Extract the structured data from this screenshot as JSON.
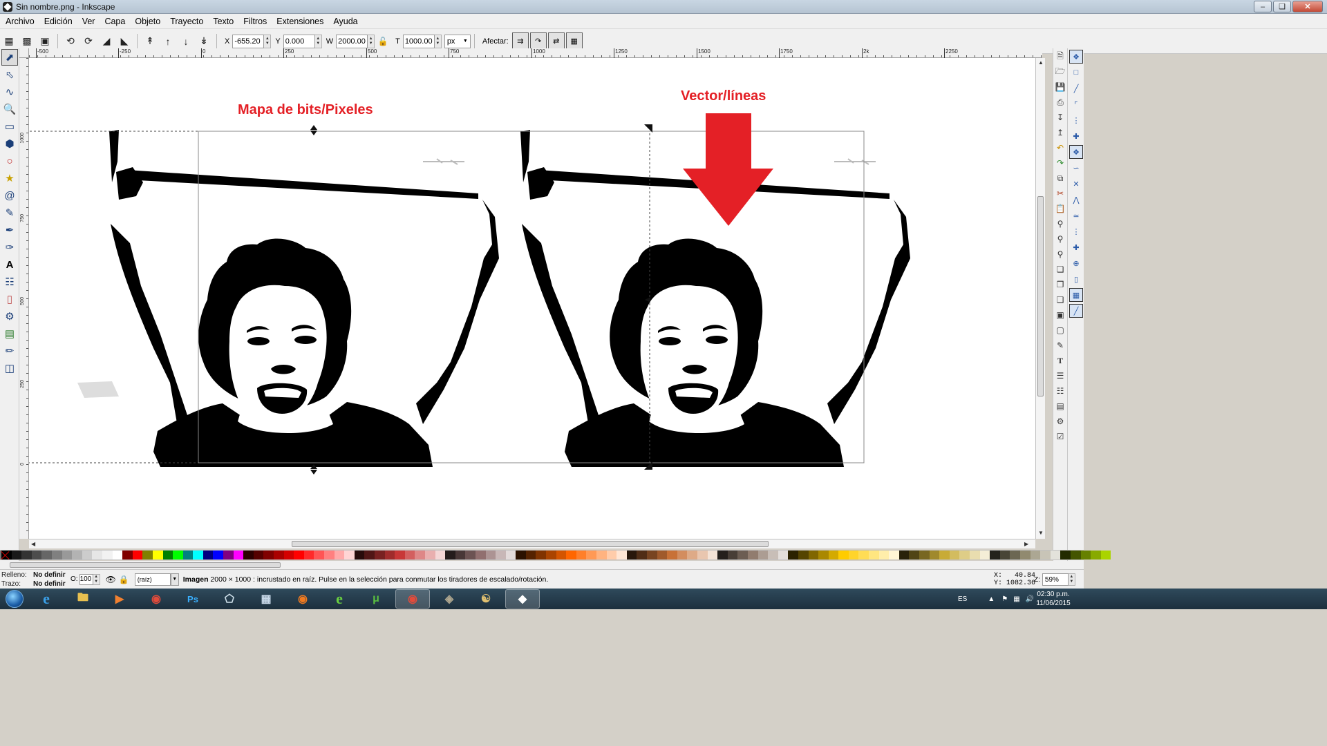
{
  "window": {
    "title": "Sin nombre.png - Inkscape"
  },
  "menu": [
    "Archivo",
    "Edición",
    "Ver",
    "Capa",
    "Objeto",
    "Trayecto",
    "Texto",
    "Filtros",
    "Extensiones",
    "Ayuda"
  ],
  "toolcontrols": {
    "x_label": "X",
    "x_value": "-655.20",
    "y_label": "Y",
    "y_value": "0.000",
    "w_label": "W",
    "w_value": "2000.00",
    "h_label": "T",
    "h_value": "1000.00",
    "unit": "px",
    "affect_label": "Afectar:"
  },
  "ruler": {
    "h_labels": [
      "-500",
      "-250",
      "0",
      "250",
      "500",
      "750",
      "1000",
      "1250",
      "1500",
      "1750",
      "2k",
      "2250"
    ],
    "v_labels": [
      "1000",
      "750",
      "500",
      "250",
      "0"
    ]
  },
  "canvas": {
    "label_bitmap": "Mapa de bits/Pixeles",
    "label_vector": "Vector/líneas",
    "arrow_color": "#e42026"
  },
  "status": {
    "fill_label": "Relleno:",
    "fill_value": "No definir",
    "stroke_label": "Trazo:",
    "stroke_value": "No definir",
    "opacity_label": "O:",
    "opacity_value": "100",
    "layer": "(raíz)",
    "message_bold": "Imagen",
    "message_rest": " 2000 × 1000 : incrustado en raíz. Pulse en la selección para conmutar los tiradores de escalado/rotación.",
    "cursor_x": "X:   40.84",
    "cursor_y": "Y: 1082.36",
    "zoom_label": "Z:",
    "zoom_value": "59%"
  },
  "taskbar": {
    "lang": "ES",
    "time": "02:30 p.m.",
    "date": "11/06/2015"
  },
  "palette": [
    "#000000",
    "#1a1a1a",
    "#333333",
    "#4d4d4d",
    "#666666",
    "#808080",
    "#999999",
    "#b3b3b3",
    "#cccccc",
    "#e6e6e6",
    "#f2f2f2",
    "#ffffff",
    "#800000",
    "#ff0000",
    "#808000",
    "#ffff00",
    "#008000",
    "#00ff00",
    "#008080",
    "#00ffff",
    "#000080",
    "#0000ff",
    "#800080",
    "#ff00ff",
    "#2b0000",
    "#550000",
    "#800000",
    "#aa0000",
    "#d40000",
    "#ff0000",
    "#ff2a2a",
    "#ff5555",
    "#ff8080",
    "#ffaaaa",
    "#ffd5d5",
    "#280b0b",
    "#501616",
    "#782121",
    "#a02c2c",
    "#c83737",
    "#d35f5f",
    "#de8787",
    "#e9afaf",
    "#f4d7d7",
    "#241c1c",
    "#483737",
    "#6c5353",
    "#916f6f",
    "#ac9393",
    "#c8b7b7",
    "#e3dbdb",
    "#2b1100",
    "#552200",
    "#803300",
    "#aa4400",
    "#d45500",
    "#ff6600",
    "#ff7f2a",
    "#ff9955",
    "#ffb380",
    "#ffccaa",
    "#ffe6d5",
    "#28170b",
    "#502d16",
    "#784421",
    "#a05a2c",
    "#c87137",
    "#d38d5f",
    "#deaa87",
    "#e9c6af",
    "#f4e3d7",
    "#241f1c",
    "#483e37",
    "#6c5d53",
    "#917c6f",
    "#ac9d93",
    "#c8beb7",
    "#e3dedb",
    "#2b2200",
    "#554400",
    "#806600",
    "#aa8800",
    "#d4aa00",
    "#ffcc00",
    "#ffd42a",
    "#ffdd55",
    "#ffe680",
    "#ffeeaa",
    "#fff6d5",
    "#28220b",
    "#504416",
    "#786721",
    "#a0892c",
    "#c8ab37",
    "#d3bc5f",
    "#decd87",
    "#e9ddaf",
    "#f4eed7",
    "#24221c",
    "#484537",
    "#6c6753",
    "#918a6f",
    "#aca793",
    "#c8c4b7",
    "#e3e2db",
    "#222b00",
    "#445500",
    "#668000",
    "#88aa00",
    "#aad400"
  ],
  "colors": {
    "accent_red": "#e42026",
    "canvas": "#ffffff",
    "chrome": "#f0f0f0"
  }
}
